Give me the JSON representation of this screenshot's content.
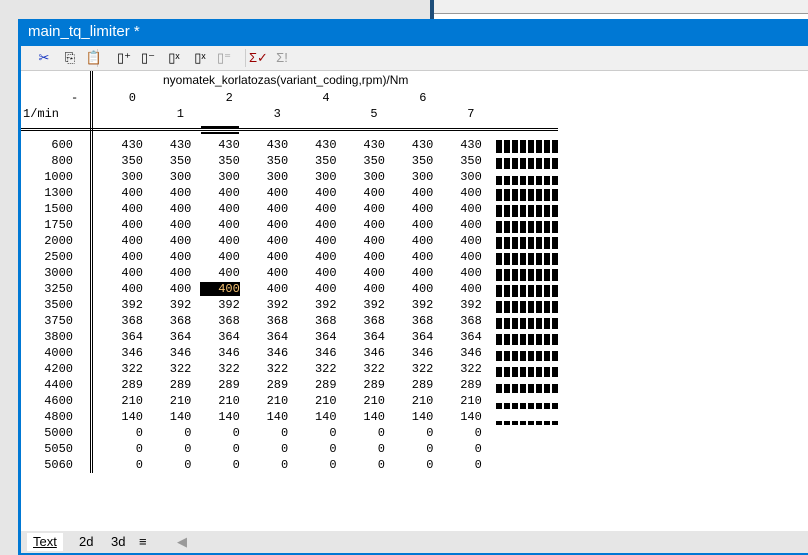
{
  "window": {
    "title": "main_tq_limiter *"
  },
  "toolbar": [
    {
      "name": "cut-icon",
      "glyph": "✂"
    },
    {
      "name": "copy-icon",
      "glyph": "⎘"
    },
    {
      "name": "paste-icon",
      "glyph": "📋"
    },
    {
      "name": "insert-row-icon",
      "glyph": "▯⁺"
    },
    {
      "name": "delete-row-icon",
      "glyph": "▯⁻"
    },
    {
      "name": "insert-column-icon",
      "glyph": "▯ˣ"
    },
    {
      "name": "delete-column-icon",
      "glyph": "▯ˣ"
    },
    {
      "name": "copy-row-icon",
      "glyph": "▯⁼"
    },
    {
      "name": "sum-check-icon",
      "glyph": "Σ✓"
    },
    {
      "name": "sum-exclaim-icon",
      "glyph": "Σ!"
    }
  ],
  "table": {
    "title": "nyomatek_korlatozas(variant_coding,rpm)/Nm",
    "x_unit": "-",
    "y_unit": "1/min",
    "columns": [
      "0",
      "1",
      "2",
      "3",
      "4",
      "5",
      "6",
      "7"
    ],
    "rows": [
      {
        "rpm": "600",
        "v": [
          430,
          430,
          430,
          430,
          430,
          430,
          430,
          430
        ]
      },
      {
        "rpm": "800",
        "v": [
          350,
          350,
          350,
          350,
          350,
          350,
          350,
          350
        ]
      },
      {
        "rpm": "1000",
        "v": [
          300,
          300,
          300,
          300,
          300,
          300,
          300,
          300
        ]
      },
      {
        "rpm": "1300",
        "v": [
          400,
          400,
          400,
          400,
          400,
          400,
          400,
          400
        ]
      },
      {
        "rpm": "1500",
        "v": [
          400,
          400,
          400,
          400,
          400,
          400,
          400,
          400
        ]
      },
      {
        "rpm": "1750",
        "v": [
          400,
          400,
          400,
          400,
          400,
          400,
          400,
          400
        ]
      },
      {
        "rpm": "2000",
        "v": [
          400,
          400,
          400,
          400,
          400,
          400,
          400,
          400
        ]
      },
      {
        "rpm": "2500",
        "v": [
          400,
          400,
          400,
          400,
          400,
          400,
          400,
          400
        ]
      },
      {
        "rpm": "3000",
        "v": [
          400,
          400,
          400,
          400,
          400,
          400,
          400,
          400
        ]
      },
      {
        "rpm": "3250",
        "v": [
          400,
          400,
          400,
          400,
          400,
          400,
          400,
          400
        ]
      },
      {
        "rpm": "3500",
        "v": [
          392,
          392,
          392,
          392,
          392,
          392,
          392,
          392
        ]
      },
      {
        "rpm": "3750",
        "v": [
          368,
          368,
          368,
          368,
          368,
          368,
          368,
          368
        ]
      },
      {
        "rpm": "3800",
        "v": [
          364,
          364,
          364,
          364,
          364,
          364,
          364,
          364
        ]
      },
      {
        "rpm": "4000",
        "v": [
          346,
          346,
          346,
          346,
          346,
          346,
          346,
          346
        ]
      },
      {
        "rpm": "4200",
        "v": [
          322,
          322,
          322,
          322,
          322,
          322,
          322,
          322
        ]
      },
      {
        "rpm": "4400",
        "v": [
          289,
          289,
          289,
          289,
          289,
          289,
          289,
          289
        ]
      },
      {
        "rpm": "4600",
        "v": [
          210,
          210,
          210,
          210,
          210,
          210,
          210,
          210
        ]
      },
      {
        "rpm": "4800",
        "v": [
          140,
          140,
          140,
          140,
          140,
          140,
          140,
          140
        ]
      },
      {
        "rpm": "5000",
        "v": [
          0,
          0,
          0,
          0,
          0,
          0,
          0,
          0
        ]
      },
      {
        "rpm": "5050",
        "v": [
          0,
          0,
          0,
          0,
          0,
          0,
          0,
          0
        ]
      },
      {
        "rpm": "5060",
        "v": [
          0,
          0,
          0,
          0,
          0,
          0,
          0,
          0
        ]
      }
    ],
    "selected": {
      "row": 9,
      "col": 2
    },
    "max_value": 430
  },
  "tabs": [
    "Text",
    "2d",
    "3d",
    "≡"
  ]
}
